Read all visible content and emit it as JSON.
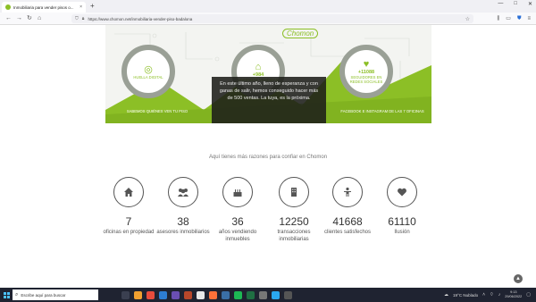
{
  "browser": {
    "tab_title": "Inmobiliaria para vender pisos o...",
    "tab_close": "×",
    "new_tab": "+",
    "url": "https://www.chomon.net/inmobiliaria-vender-piso-badalona",
    "window_controls": [
      "—",
      "□",
      "✕"
    ]
  },
  "banner": {
    "logo": "Chomon",
    "stats": [
      {
        "stat": "",
        "text": "HUELLA DIGITAL",
        "icon": "fingerprint-icon",
        "caption": "SABEMOS QUIÉNES VEN TU PISO"
      },
      {
        "stat": "+984",
        "text": "VIVIENDAS VENDIDAS",
        "icon": "house-icon",
        "caption": ""
      },
      {
        "stat": "+11088",
        "text": "SEGUIDORES EN REDES SOCIALES",
        "icon": "like-icon",
        "caption": "FACEBOOK E INSTAGRAM DE LAS 7 OFICINAS"
      }
    ],
    "overlay_text": "En este último año, lleno de esperanza y con ganas de salir, hemos conseguido hacer más de 500 ventas. La tuya, es la próxima."
  },
  "section": {
    "title": "Aquí tienes más razones para confiar en Chomon"
  },
  "features": [
    {
      "icon": "home-icon",
      "number": "7",
      "label": "oficinas en propiedad"
    },
    {
      "icon": "users-icon",
      "number": "38",
      "label": "asesores inmobiliarios"
    },
    {
      "icon": "cake-icon",
      "number": "36",
      "label": "años vendiendo inmuebles"
    },
    {
      "icon": "building-icon",
      "number": "12250",
      "label": "transacciones inmobiliarias"
    },
    {
      "icon": "person-icon",
      "number": "41668",
      "label": "clientes satisfechos"
    },
    {
      "icon": "heart-icon",
      "number": "61110",
      "label": "Ilusión"
    }
  ],
  "taskbar": {
    "search_placeholder": "Escribe aquí para buscar",
    "weather": "19°C Nublado",
    "time": "9:13",
    "date": "29/06/2022"
  },
  "colors": {
    "accent": "#8cbf26",
    "overlay": "#1c1e19",
    "taskbar": "#1f2331"
  }
}
